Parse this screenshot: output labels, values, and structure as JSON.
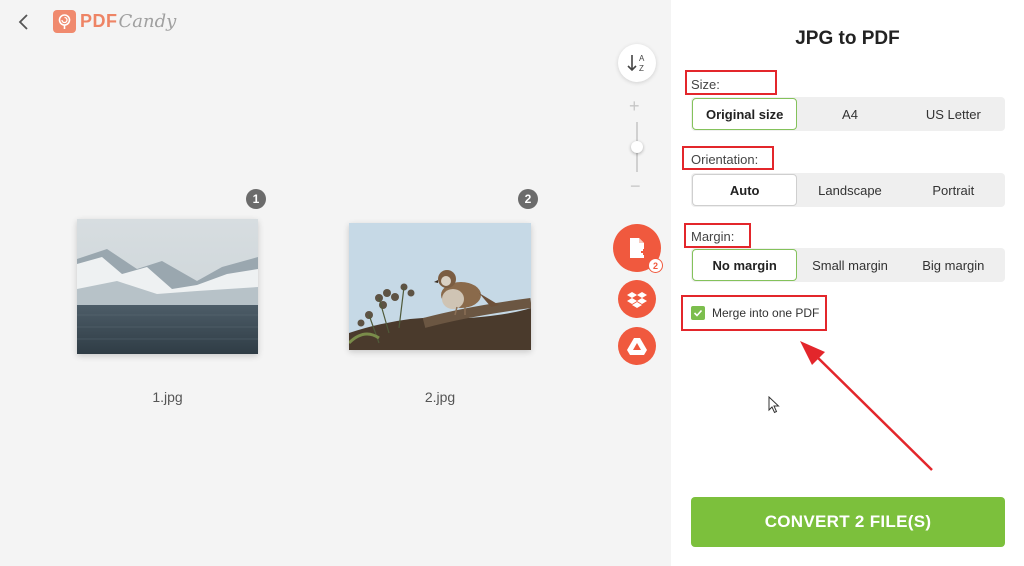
{
  "app": {
    "logo_pdf": "PDF",
    "logo_candy": "Candy"
  },
  "files": [
    {
      "name": "1.jpg",
      "index": "1"
    },
    {
      "name": "2.jpg",
      "index": "2"
    }
  ],
  "tools": {
    "add_count": "2"
  },
  "panel": {
    "title": "JPG to PDF",
    "size": {
      "label": "Size:",
      "options": [
        "Original size",
        "A4",
        "US Letter"
      ],
      "selected": "Original size"
    },
    "orientation": {
      "label": "Orientation:",
      "options": [
        "Auto",
        "Landscape",
        "Portrait"
      ],
      "selected": "Auto"
    },
    "margin": {
      "label": "Margin:",
      "options": [
        "No margin",
        "Small margin",
        "Big margin"
      ],
      "selected": "No margin"
    },
    "merge_label": "Merge into one PDF",
    "merge_checked": true,
    "convert_label": "CONVERT 2 FILE(S)"
  },
  "colors": {
    "accent_green": "#7cc03c",
    "brand_orange": "#f0593e",
    "annotation_red": "#e3262b"
  }
}
